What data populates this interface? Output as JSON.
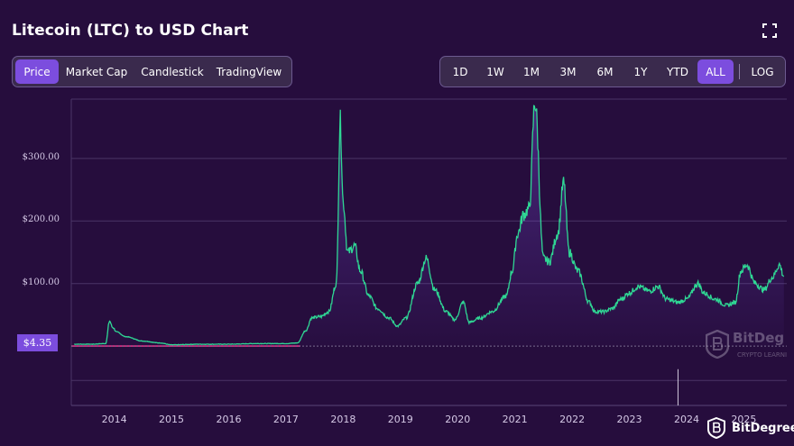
{
  "header": {
    "title": "Litecoin (LTC) to USD Chart",
    "expand_icon": "expand-icon"
  },
  "chart_tabs": [
    {
      "label": "Price",
      "active": true
    },
    {
      "label": "Market Cap",
      "active": false
    },
    {
      "label": "Candlestick",
      "active": false
    },
    {
      "label": "TradingView",
      "active": false
    }
  ],
  "ranges": [
    {
      "label": "1D",
      "active": false
    },
    {
      "label": "1W",
      "active": false
    },
    {
      "label": "1M",
      "active": false
    },
    {
      "label": "3M",
      "active": false
    },
    {
      "label": "6M",
      "active": false
    },
    {
      "label": "1Y",
      "active": false
    },
    {
      "label": "YTD",
      "active": false
    },
    {
      "label": "ALL",
      "active": true
    }
  ],
  "log_label": "LOG",
  "current_price_label": "$4.35",
  "watermark": {
    "text": "BitDeg",
    "sub": "CRYPTO LEARNI"
  },
  "brand": {
    "name": "BitDegree",
    "icon": "bitdegree-logo-icon"
  },
  "colors": {
    "background": "#260d3d",
    "line": "#2fd794",
    "baseline": "#e02f85",
    "accent": "#7c4dde"
  },
  "chart_data": {
    "type": "line",
    "title": "Litecoin (LTC) to USD Chart",
    "xlabel": "",
    "ylabel": "",
    "y_ticks": [
      "$100.00",
      "$200.00",
      "$300.00"
    ],
    "x_ticks": [
      "2014",
      "2015",
      "2016",
      "2017",
      "2018",
      "2019",
      "2020",
      "2021",
      "2022",
      "2023",
      "2024",
      "2025"
    ],
    "ylim": [
      -95,
      395
    ],
    "xlim": [
      2013.25,
      2025.75
    ],
    "grid": true,
    "series": [
      {
        "values": [
          [
            2013.3,
            3
          ],
          [
            2013.6,
            3
          ],
          [
            2013.85,
            4
          ],
          [
            2013.92,
            40
          ],
          [
            2013.97,
            30
          ],
          [
            2014.05,
            22
          ],
          [
            2014.2,
            15
          ],
          [
            2014.5,
            8
          ],
          [
            2014.8,
            5
          ],
          [
            2015.0,
            2
          ],
          [
            2015.5,
            3
          ],
          [
            2016.0,
            3
          ],
          [
            2016.5,
            4
          ],
          [
            2017.0,
            4
          ],
          [
            2017.2,
            5
          ],
          [
            2017.35,
            25
          ],
          [
            2017.45,
            45
          ],
          [
            2017.6,
            47
          ],
          [
            2017.75,
            55
          ],
          [
            2017.88,
            100
          ],
          [
            2017.95,
            360
          ],
          [
            2018.0,
            230
          ],
          [
            2018.08,
            150
          ],
          [
            2018.2,
            160
          ],
          [
            2018.3,
            120
          ],
          [
            2018.45,
            80
          ],
          [
            2018.6,
            60
          ],
          [
            2018.8,
            45
          ],
          [
            2018.95,
            32
          ],
          [
            2019.1,
            45
          ],
          [
            2019.3,
            100
          ],
          [
            2019.45,
            140
          ],
          [
            2019.6,
            90
          ],
          [
            2019.8,
            55
          ],
          [
            2019.95,
            42
          ],
          [
            2020.1,
            70
          ],
          [
            2020.2,
            38
          ],
          [
            2020.4,
            45
          ],
          [
            2020.6,
            55
          ],
          [
            2020.85,
            80
          ],
          [
            2020.95,
            120
          ],
          [
            2021.05,
            180
          ],
          [
            2021.15,
            210
          ],
          [
            2021.25,
            220
          ],
          [
            2021.35,
            390
          ],
          [
            2021.5,
            140
          ],
          [
            2021.6,
            135
          ],
          [
            2021.75,
            180
          ],
          [
            2021.85,
            260
          ],
          [
            2021.95,
            150
          ],
          [
            2022.1,
            120
          ],
          [
            2022.3,
            70
          ],
          [
            2022.4,
            55
          ],
          [
            2022.55,
            55
          ],
          [
            2022.7,
            60
          ],
          [
            2022.85,
            75
          ],
          [
            2023.0,
            85
          ],
          [
            2023.15,
            95
          ],
          [
            2023.35,
            88
          ],
          [
            2023.5,
            95
          ],
          [
            2023.65,
            75
          ],
          [
            2023.85,
            70
          ],
          [
            2024.0,
            75
          ],
          [
            2024.2,
            100
          ],
          [
            2024.3,
            85
          ],
          [
            2024.5,
            75
          ],
          [
            2024.7,
            65
          ],
          [
            2024.85,
            70
          ],
          [
            2024.95,
            120
          ],
          [
            2025.05,
            130
          ],
          [
            2025.2,
            100
          ],
          [
            2025.35,
            90
          ],
          [
            2025.5,
            110
          ],
          [
            2025.62,
            130
          ],
          [
            2025.7,
            112
          ]
        ]
      }
    ]
  }
}
